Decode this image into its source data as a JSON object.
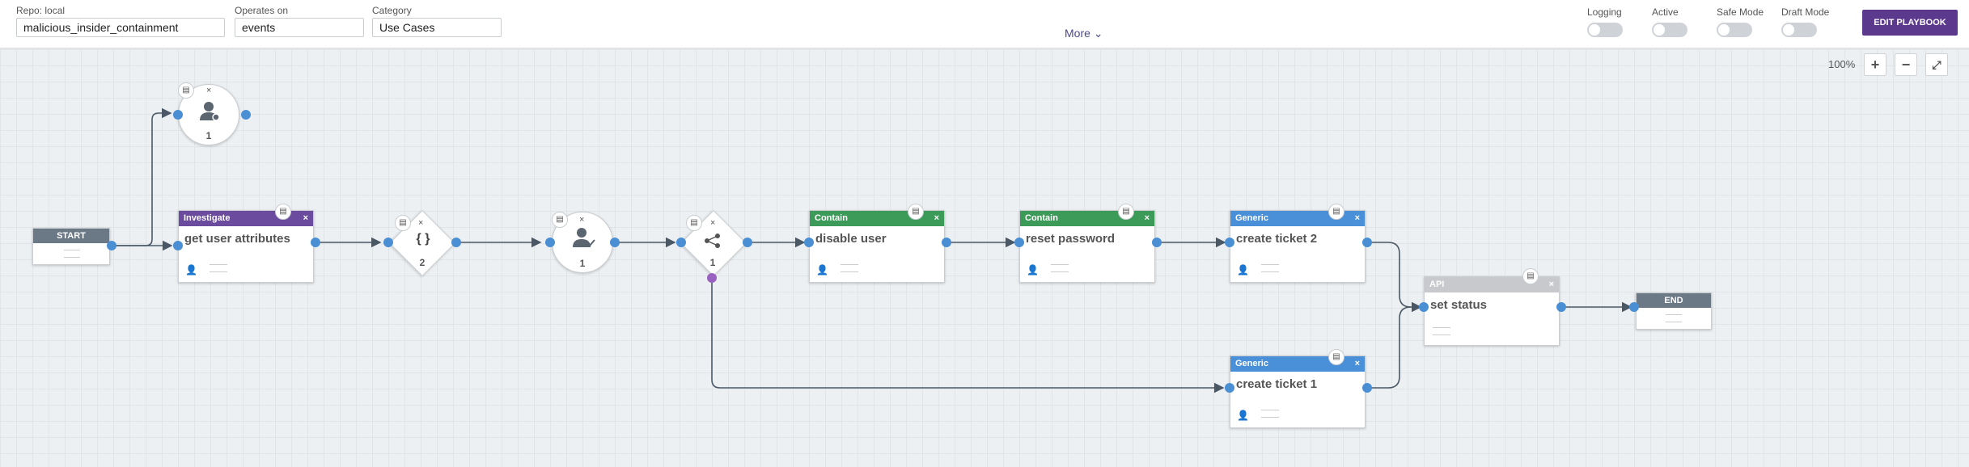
{
  "toolbar": {
    "repo_label": "Repo: local",
    "playbook_name": "malicious_insider_containment",
    "operates_on_label": "Operates on",
    "operates_on_value": "events",
    "category_label": "Category",
    "category_value": "Use Cases",
    "more_label": "More ⌄",
    "logging_label": "Logging",
    "active_label": "Active",
    "safe_mode_label": "Safe Mode",
    "draft_mode_label": "Draft Mode",
    "edit_button": "EDIT PLAYBOOK"
  },
  "canvas": {
    "zoom": "100%",
    "zoom_in": "+",
    "zoom_out": "−",
    "fit": "⤢"
  },
  "nodes": {
    "start": "START",
    "end": "END",
    "prompt_top_count": "1",
    "investigate": {
      "type": "Investigate",
      "title": "get user attributes",
      "color": "#6b4b9e"
    },
    "decision_format": {
      "symbol": "{ }",
      "count": "2"
    },
    "prompt_approve_count": "1",
    "filter": {
      "count": "1"
    },
    "disable_user": {
      "type": "Contain",
      "title": "disable user",
      "color": "#3d9b5a"
    },
    "reset_password": {
      "type": "Contain",
      "title": "reset password",
      "color": "#3d9b5a"
    },
    "ticket2": {
      "type": "Generic",
      "title": "create ticket 2",
      "color": "#4a90d9"
    },
    "ticket1": {
      "type": "Generic",
      "title": "create ticket 1",
      "color": "#4a90d9"
    },
    "set_status": {
      "type": "API",
      "title": "set status",
      "color": "#c7c9cc"
    }
  },
  "icons": {
    "doc": "▤",
    "close": "×",
    "user": "👤",
    "share": "⋖"
  }
}
